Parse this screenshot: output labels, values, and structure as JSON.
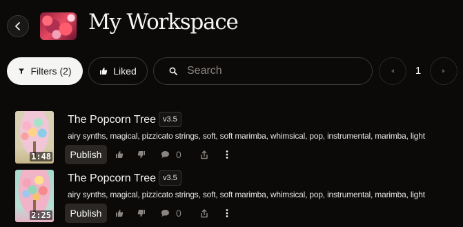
{
  "header": {
    "back_icon": "chevron-left-icon",
    "title": "My Workspace"
  },
  "toolbar": {
    "filters_label": "Filters (2)",
    "liked_label": "Liked",
    "search_placeholder": "Search",
    "search_value": "",
    "page_number": "1"
  },
  "songs": [
    {
      "title": "The Popcorn Tree",
      "version": "v3.5",
      "tags": "airy synths, magical, pizzicato strings, soft, soft marimba, whimsical, pop, instrumental, marimba, light",
      "duration": "1:48",
      "publish_label": "Publish",
      "comment_count": "0"
    },
    {
      "title": "The Popcorn Tree",
      "version": "v3.5",
      "tags": "airy synths, magical, pizzicato strings, soft, soft marimba, whimsical, pop, instrumental, marimba, light",
      "duration": "2:25",
      "publish_label": "Publish",
      "comment_count": "0"
    }
  ],
  "colors": {
    "background": "#0c0a09",
    "filters_button_bg": "#f5f5f4",
    "publish_button_bg": "#2a2725",
    "muted_icon": "#8a8580"
  }
}
